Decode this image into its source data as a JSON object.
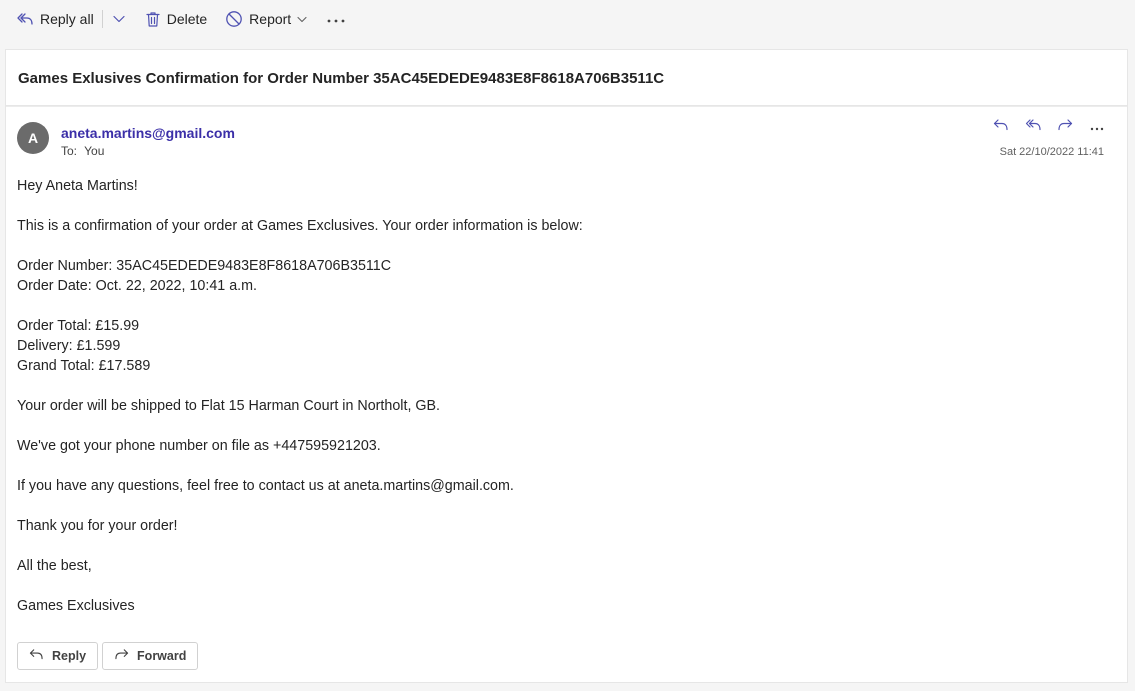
{
  "toolbar": {
    "reply_all_label": "Reply all",
    "delete_label": "Delete",
    "report_label": "Report",
    "more_label": "···"
  },
  "email": {
    "subject": "Games Exlusives Confirmation for Order Number 35AC45EDEDE9483E8F8618A706B3511C",
    "avatar_initial": "A",
    "sender": "aneta.martins@gmail.com",
    "to_label": "To:",
    "to_value": "You",
    "date": "Sat 22/10/2022 11:41",
    "body": {
      "greeting": "Hey Aneta Martins!",
      "intro": "This is a confirmation of your order at Games Exclusives. Your order information is below:",
      "order_number": "Order Number: 35AC45EDEDE9483E8F8618A706B3511C",
      "order_date": "Order Date: Oct. 22, 2022, 10:41 a.m.",
      "order_total": "Order Total: £15.99",
      "delivery": "Delivery: £1.599",
      "grand_total": "Grand Total: £17.589",
      "shipping": "Your order will be shipped to Flat 15 Harman Court in Northolt, GB.",
      "phone": "We've got your phone number on file as +447595921203.",
      "questions": "If you have any questions, feel free to contact us at aneta.martins@gmail.com.",
      "thanks": "Thank you for your order!",
      "signoff": "All the best,",
      "signature": "Games Exclusives"
    }
  },
  "footer": {
    "reply_label": "Reply",
    "forward_label": "Forward"
  },
  "icons": {
    "reply_all": "reply-all-icon",
    "delete": "trash-icon",
    "report": "block-icon",
    "reply": "reply-icon",
    "forward": "forward-icon",
    "more": "more-icon"
  },
  "colors": {
    "accent": "#3b2fa8",
    "avatar": "#6b6b6b",
    "toolbar_icon": "#4f52b2"
  }
}
